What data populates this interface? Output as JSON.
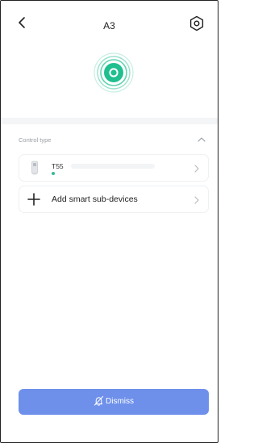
{
  "header": {
    "title": "A3"
  },
  "section": {
    "label": "Control type"
  },
  "devices": [
    {
      "name": "T55",
      "status_color": "#3bb89a"
    }
  ],
  "add_device": {
    "label": "Add smart sub-devices"
  },
  "dismiss": {
    "label": "Dismiss"
  },
  "colors": {
    "accent": "#6e90eb",
    "online": "#3bb89a",
    "radar_green": "#1fbf8f"
  },
  "icons": [
    "back-icon",
    "settings-icon",
    "radar-icon",
    "chevron-up-icon",
    "device-icon",
    "chevron-right-icon",
    "plus-icon",
    "bell-off-icon"
  ]
}
